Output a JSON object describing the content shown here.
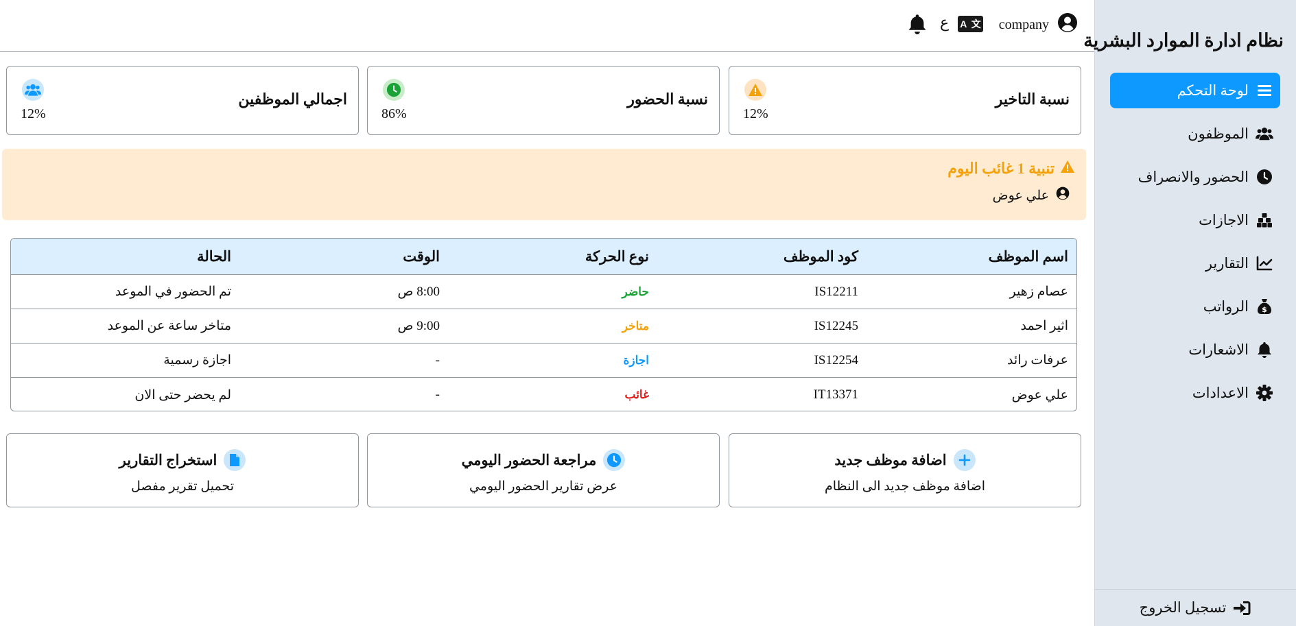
{
  "sidebar": {
    "title": "نظام ادارة الموارد البشرية",
    "items": [
      {
        "label": "لوحة التحكم",
        "icon": "menu-icon",
        "active": true
      },
      {
        "label": "الموظفون",
        "icon": "users-icon",
        "active": false
      },
      {
        "label": "الحضور والانصراف",
        "icon": "clock-icon",
        "active": false
      },
      {
        "label": "الاجازات",
        "icon": "cubes-icon",
        "active": false
      },
      {
        "label": "التقارير",
        "icon": "chart-line-icon",
        "active": false
      },
      {
        "label": "الرواتب",
        "icon": "money-bag-icon",
        "active": false
      },
      {
        "label": "الاشعارات",
        "icon": "bell-icon",
        "active": false
      },
      {
        "label": "الاعدادات",
        "icon": "gear-icon",
        "active": false
      }
    ],
    "logout_label": "تسجيل الخروج"
  },
  "topbar": {
    "user_name": "company",
    "lang_char": "ع",
    "lang_badge_left": "A",
    "lang_badge_right": "文"
  },
  "stats": [
    {
      "title": "نسبة التاخير",
      "value": "12%",
      "icon": "warning-icon",
      "color": "#f5a10a",
      "bg": "#fde3c2"
    },
    {
      "title": "نسبة الحضور",
      "value": "86%",
      "icon": "clock-icon",
      "color": "#19a337",
      "bg": "#c8ecc8"
    },
    {
      "title": "اجمالي الموظفين",
      "value": "12%",
      "icon": "users-icon",
      "color": "#0d99ff",
      "bg": "#c9e6fb"
    }
  ],
  "alert": {
    "title": "تنبية 1 غائب اليوم",
    "employee": "علي عوض",
    "color": "#f5a10a"
  },
  "table": {
    "headers": [
      "اسم الموظف",
      "كود الموظف",
      "نوع الحركة",
      "الوقت",
      "الحالة"
    ],
    "rows": [
      {
        "name": "عصام زهير",
        "code": "IS12211",
        "movement": "حاضر",
        "movement_color": "#19a337",
        "time": "8:00 ص",
        "status": "تم الحضور في الموعد"
      },
      {
        "name": "اثير احمد",
        "code": "IS12245",
        "movement": "متاخر",
        "movement_color": "#f5a10a",
        "time": "9:00 ص",
        "status": "متاخر ساعة عن الموعد"
      },
      {
        "name": "عرفات رائد",
        "code": "IS12254",
        "movement": "اجازة",
        "movement_color": "#0d99ff",
        "time": "-",
        "status": "اجازة رسمية"
      },
      {
        "name": "علي عوض",
        "code": "IT13371",
        "movement": "غائب",
        "movement_color": "#e01b1b",
        "time": "-",
        "status": "لم يحضر حتى الان"
      }
    ]
  },
  "actions": [
    {
      "title": "اضافة موظف جديد",
      "desc": "اضافة موظف جديد الى النظام",
      "icon": "plus-icon"
    },
    {
      "title": "مراجعة الحضور اليومي",
      "desc": "عرض تقارير الحضور اليومي",
      "icon": "clock-icon"
    },
    {
      "title": "استخراج التقارير",
      "desc": "تحميل تقرير مفصل",
      "icon": "file-icon"
    }
  ]
}
